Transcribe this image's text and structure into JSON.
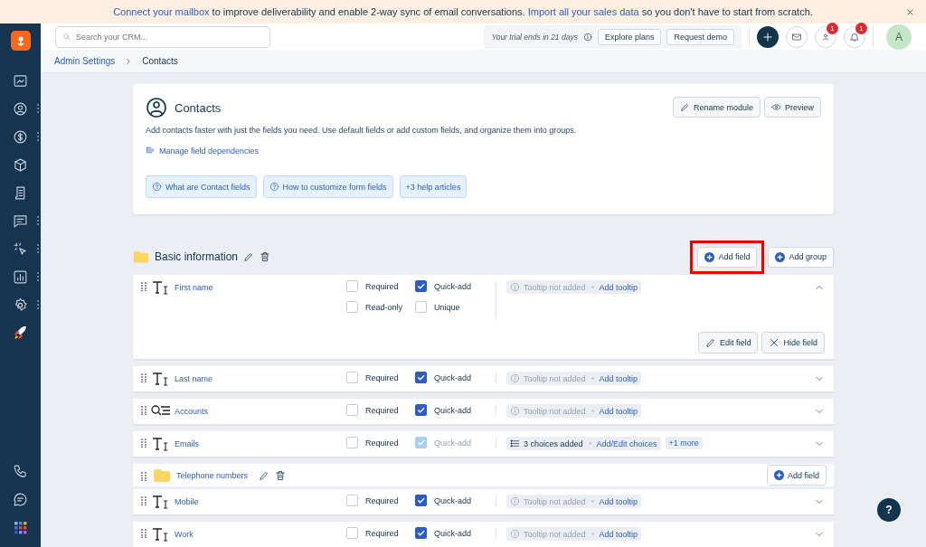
{
  "banner": {
    "parts": [
      {
        "text": "Connect your mailbox",
        "link": true
      },
      {
        "text": " to improve deliverability and enable 2-way sync of email conversations. ",
        "link": false
      },
      {
        "text": "Import all your sales data",
        "link": true
      },
      {
        "text": " so you don't have to start from scratch.",
        "link": false
      }
    ]
  },
  "topbar": {
    "search": {
      "placeholder": "Search your CRM..."
    },
    "trial": "Your trial ends in 21 days",
    "buttons": [
      "Explore plans",
      "Request demo"
    ],
    "badges": [
      {
        "kind": "contacts",
        "count": "1"
      },
      {
        "kind": "bell",
        "count": "1"
      }
    ],
    "avatar": "A"
  },
  "sidebar": {
    "top": [
      {
        "kind": "dashboard",
        "menu": false
      },
      {
        "kind": "contact",
        "menu": true
      },
      {
        "kind": "dollar",
        "menu": true
      },
      {
        "kind": "box",
        "menu": false
      },
      {
        "kind": "document",
        "menu": false
      },
      {
        "kind": "chat",
        "menu": true
      },
      {
        "kind": "sparkle",
        "menu": true
      },
      {
        "kind": "chart",
        "menu": true
      },
      {
        "kind": "gear",
        "menu": true
      },
      {
        "kind": "rocket",
        "menu": false
      }
    ],
    "bottom": [
      {
        "kind": "phone",
        "menu": false
      },
      {
        "kind": "message",
        "menu": false
      },
      {
        "kind": "apps",
        "menu": false
      }
    ]
  },
  "breadcrumb": [
    {
      "label": "Admin Settings",
      "link": true
    },
    {
      "label": "Contacts",
      "link": false
    }
  ],
  "module": {
    "title": "Contacts",
    "description": "Add contacts faster with just the fields you need. Use default fields or add custom fields, and organize them into groups.",
    "link": "Manage field dependencies",
    "buttons": [
      {
        "kind": "rename",
        "label": "Rename module"
      },
      {
        "kind": "preview",
        "label": "Preview"
      }
    ],
    "help": [
      {
        "label": "What are Contact fields",
        "icon": true
      },
      {
        "label": "How to customize form fields",
        "icon": true
      },
      {
        "label": "+3 help articles",
        "icon": false
      }
    ]
  },
  "section": {
    "title": "Basic information",
    "actions": [
      {
        "label": "Add field",
        "highlighted": true
      },
      {
        "label": "Add group",
        "highlighted": false
      }
    ],
    "rows": [
      {
        "kind": "text_field",
        "name": "First name",
        "expanded": true,
        "options": [
          {
            "label": "Required",
            "checked": false,
            "disabled": false
          },
          {
            "label": "Quick-add",
            "checked": true,
            "disabled": false
          },
          {
            "label": "Read-only",
            "checked": false,
            "disabled": false
          },
          {
            "label": "Unique",
            "checked": false,
            "disabled": false
          }
        ],
        "info": {
          "kind": "tooltip",
          "status": "Tooltip not added",
          "action": "Add tooltip"
        },
        "buttons": [
          {
            "kind": "edit",
            "label": "Edit field"
          },
          {
            "kind": "hide",
            "label": "Hide field"
          }
        ]
      },
      {
        "kind": "text_field",
        "name": "Last name",
        "expanded": false,
        "options": [
          {
            "label": "Required",
            "checked": false,
            "disabled": false
          },
          {
            "label": "Quick-add",
            "checked": true,
            "disabled": false
          }
        ],
        "info": {
          "kind": "tooltip",
          "status": "Tooltip not added",
          "action": "Add tooltip"
        }
      },
      {
        "kind": "lookup_field",
        "name": "Accounts",
        "expanded": false,
        "options": [
          {
            "label": "Required",
            "checked": false,
            "disabled": false
          },
          {
            "label": "Quick-add",
            "checked": true,
            "disabled": false
          }
        ],
        "info": {
          "kind": "tooltip",
          "status": "Tooltip not added",
          "action": "Add tooltip"
        }
      },
      {
        "kind": "text_field",
        "name": "Emails",
        "expanded": false,
        "options": [
          {
            "label": "Required",
            "checked": false,
            "disabled": false
          },
          {
            "label": "Quick-add",
            "checked": true,
            "disabled": true
          }
        ],
        "info": {
          "kind": "choices",
          "status": "3 choices added",
          "action": "Add/Edit choices",
          "more": "+1 more"
        }
      },
      {
        "kind": "group",
        "name": "Telephone numbers",
        "action": "Add field"
      },
      {
        "kind": "text_field",
        "name": "Mobile",
        "expanded": false,
        "options": [
          {
            "label": "Required",
            "checked": false,
            "disabled": false
          },
          {
            "label": "Quick-add",
            "checked": true,
            "disabled": false
          }
        ],
        "info": {
          "kind": "tooltip",
          "status": "Tooltip not added",
          "action": "Add tooltip"
        }
      },
      {
        "kind": "text_field",
        "name": "Work",
        "expanded": false,
        "options": [
          {
            "label": "Required",
            "checked": false,
            "disabled": false
          },
          {
            "label": "Quick-add",
            "checked": true,
            "disabled": false
          }
        ],
        "info": {
          "kind": "tooltip",
          "status": "Tooltip not added",
          "action": "Add tooltip"
        }
      }
    ]
  },
  "help_button": "?"
}
